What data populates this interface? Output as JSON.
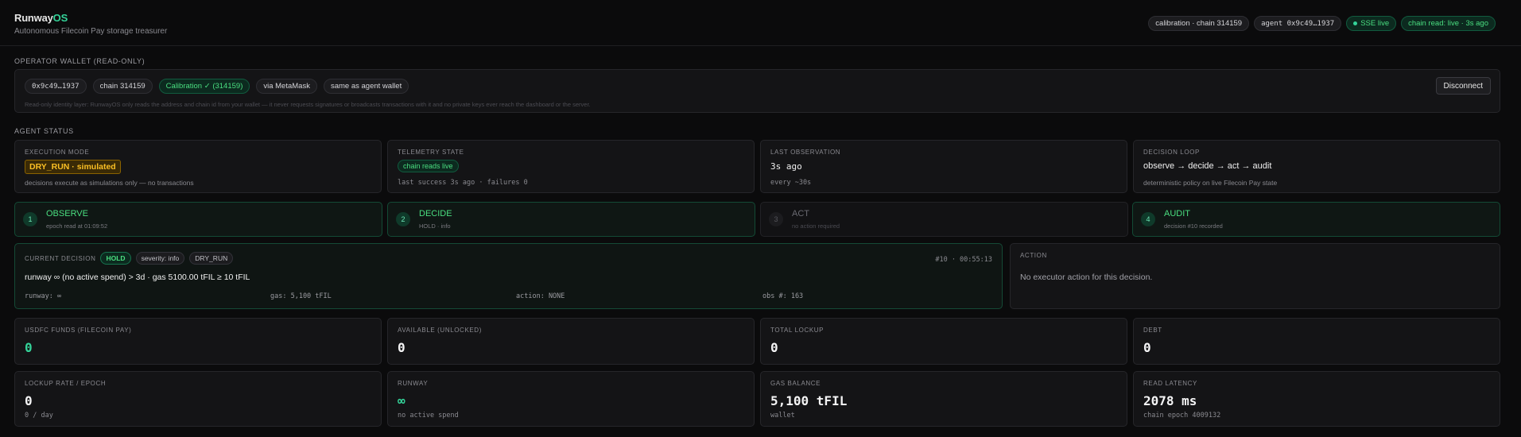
{
  "header": {
    "brand_main": "Runway",
    "brand_accent": "OS",
    "subtitle": "Autonomous Filecoin Pay storage treasurer",
    "pills": {
      "network": "calibration · chain 314159",
      "agent": "agent 0x9c49…1937",
      "sse": "SSE live",
      "chain_read": "chain read: live · 3s ago"
    }
  },
  "operator": {
    "title": "OPERATOR WALLET (READ-ONLY)",
    "address": "0x9c49…1937",
    "chain": "chain 314159",
    "network": "Calibration ✓ (314159)",
    "via": "via MetaMask",
    "same": "same as agent wallet",
    "note": "Read-only identity layer: RunwayOS only reads the address and chain id from your wallet — it never requests signatures or broadcasts transactions with it and no private keys ever reach the dashboard or the server.",
    "disconnect": "Disconnect"
  },
  "agent_status": {
    "title": "AGENT STATUS",
    "execution_mode": {
      "label": "EXECUTION MODE",
      "value": "DRY_RUN · simulated",
      "sub": "decisions execute as simulations only — no transactions"
    },
    "telemetry": {
      "label": "TELEMETRY STATE",
      "value": "chain reads live",
      "sub": "last success 3s ago · failures 0"
    },
    "observation": {
      "label": "LAST OBSERVATION",
      "value": "3s ago",
      "sub": "every ~30s"
    },
    "loop": {
      "label": "DECISION LOOP",
      "value": "observe → decide → act → audit",
      "sub": "deterministic policy on live Filecoin Pay state"
    }
  },
  "steps": [
    {
      "num": "1",
      "title": "OBSERVE",
      "sub": "epoch read at 01:09:52",
      "active": true
    },
    {
      "num": "2",
      "title": "DECIDE",
      "sub": "HOLD · info",
      "active": true
    },
    {
      "num": "3",
      "title": "ACT",
      "sub": "no action required",
      "active": false
    },
    {
      "num": "4",
      "title": "AUDIT",
      "sub": "decision #10 recorded",
      "active": true
    }
  ],
  "decision": {
    "label": "CURRENT DECISION",
    "verdict": "HOLD",
    "severity": "severity: info",
    "mode": "DRY_RUN",
    "meta": "#10 · 00:55:13",
    "summary": "runway ∞ (no active spend) > 3d · gas 5100.00 tFIL ≥ 10 tFIL",
    "runway": "runway: ∞",
    "gas": "gas: 5,100 tFIL",
    "action": "action: NONE",
    "obs": "obs #: 163"
  },
  "action_panel": {
    "label": "ACTION",
    "text": "No executor action for this decision."
  },
  "metrics_row1": [
    {
      "label": "USDFC FUNDS (FILECOIN PAY)",
      "value": "0",
      "sub": "",
      "green": true
    },
    {
      "label": "AVAILABLE (UNLOCKED)",
      "value": "0",
      "sub": "",
      "green": false
    },
    {
      "label": "TOTAL LOCKUP",
      "value": "0",
      "sub": "",
      "green": false
    },
    {
      "label": "DEBT",
      "value": "0",
      "sub": "",
      "green": false
    }
  ],
  "metrics_row2": [
    {
      "label": "LOCKUP RATE / EPOCH",
      "value": "0",
      "sub": "0 / day",
      "green": false
    },
    {
      "label": "RUNWAY",
      "value": "∞",
      "sub": "no active spend",
      "green": true
    },
    {
      "label": "GAS BALANCE",
      "value": "5,100 tFIL",
      "sub": "wallet",
      "green": false
    },
    {
      "label": "READ LATENCY",
      "value": "2078 ms",
      "sub": "chain epoch 4009132",
      "green": false
    }
  ]
}
